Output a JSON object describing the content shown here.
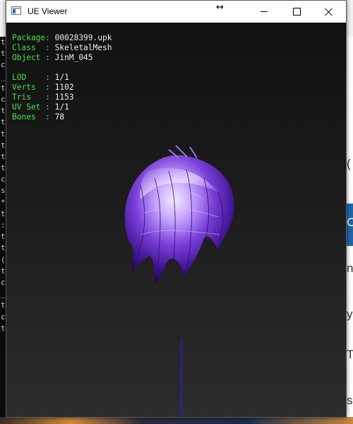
{
  "window": {
    "title": "UE Viewer"
  },
  "info": {
    "package_key": "Package",
    "package_value": "00028399.upk",
    "class_key": "Class  ",
    "class_value": "SkeletalMesh",
    "object_key": "Object ",
    "object_value": "JinM_045",
    "lod_key": "LOD    ",
    "lod_value": "1/1",
    "verts_key": "Verts  ",
    "verts_value": "1102",
    "tris_key": "Tris   ",
    "tris_value": "1153",
    "uvset_key": "UV Set ",
    "uvset_value": "1/1",
    "bones_key": "Bones  ",
    "bones_value": "78"
  },
  "background": {
    "console_lines": [
      "t",
      "t",
      "c",
      "_",
      "t",
      "c",
      "t",
      "t",
      "t",
      "t",
      "t",
      "t",
      "c",
      "s",
      "*",
      "t",
      ":",
      "t",
      "t",
      "(",
      "t",
      "c",
      "_",
      "t",
      "c",
      "t"
    ],
    "right_fragments": [
      "(",
      "C",
      "na",
      "y",
      "T",
      "s"
    ]
  },
  "colors": {
    "key_green": "#48e048",
    "value_white": "#ececec",
    "hair_purple": "#7a3fd8",
    "axis_blue": "#1a22b0"
  }
}
